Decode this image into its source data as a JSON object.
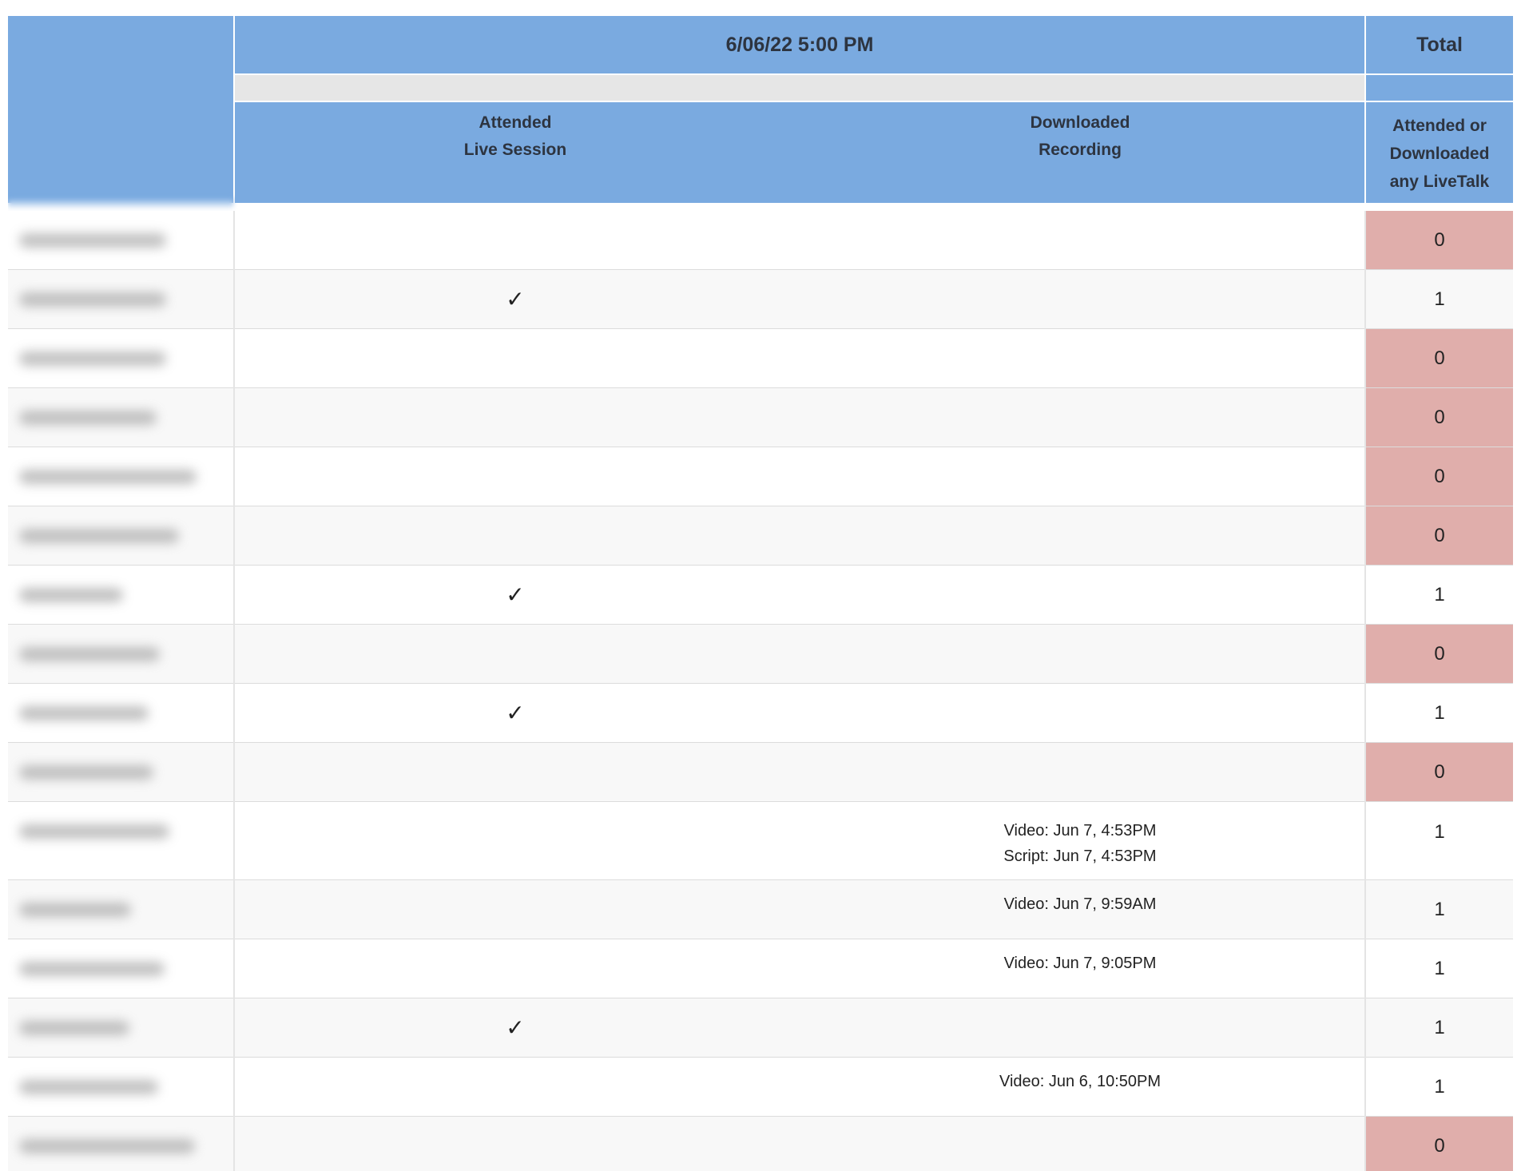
{
  "header": {
    "session_title": "6/06/22 5:00 PM",
    "total_title": "Total",
    "col_attended": [
      "Attended",
      "Live Session"
    ],
    "col_downloaded": [
      "Downloaded",
      "Recording"
    ],
    "col_total": [
      "Attended or",
      "Downloaded",
      "any LiveTalk"
    ]
  },
  "check_symbol": "✓",
  "colors": {
    "header_blue": "#7aaae0",
    "zero_highlight": "#e0aeab",
    "band_gray": "#e6e6e6"
  },
  "rows": [
    {
      "attended": "",
      "recording": [],
      "total": "0"
    },
    {
      "attended": "✓",
      "recording": [],
      "total": "1"
    },
    {
      "attended": "",
      "recording": [],
      "total": "0"
    },
    {
      "attended": "",
      "recording": [],
      "total": "0"
    },
    {
      "attended": "",
      "recording": [],
      "total": "0"
    },
    {
      "attended": "",
      "recording": [],
      "total": "0"
    },
    {
      "attended": "✓",
      "recording": [],
      "total": "1"
    },
    {
      "attended": "",
      "recording": [],
      "total": "0"
    },
    {
      "attended": "✓",
      "recording": [],
      "total": "1"
    },
    {
      "attended": "",
      "recording": [],
      "total": "0"
    },
    {
      "attended": "",
      "recording": [
        "Video: Jun 7, 4:53PM",
        "Script: Jun 7, 4:53PM"
      ],
      "total": "1"
    },
    {
      "attended": "",
      "recording": [
        "Video: Jun 7, 9:59AM"
      ],
      "total": "1"
    },
    {
      "attended": "",
      "recording": [
        "Video: Jun 7, 9:05PM"
      ],
      "total": "1"
    },
    {
      "attended": "✓",
      "recording": [],
      "total": "1"
    },
    {
      "attended": "",
      "recording": [
        "Video: Jun 6, 10:50PM"
      ],
      "total": "1"
    },
    {
      "attended": "",
      "recording": [],
      "total": "0"
    }
  ]
}
